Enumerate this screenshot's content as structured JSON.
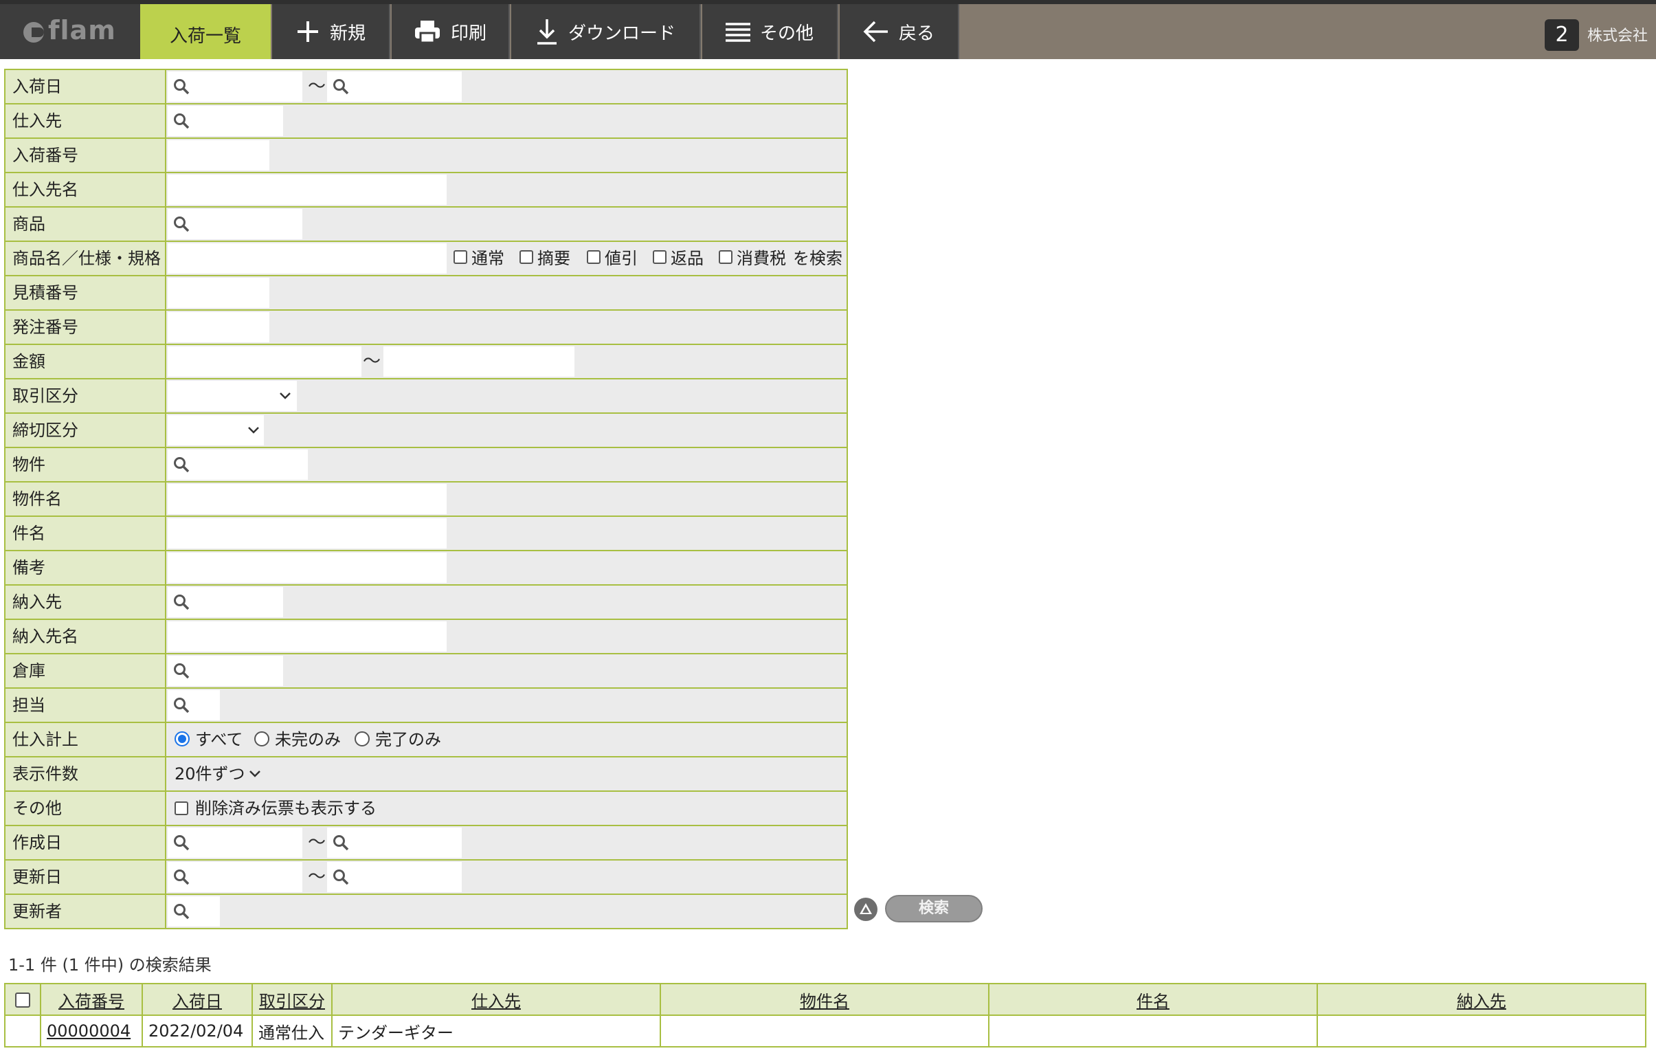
{
  "app": {
    "logo": "flam"
  },
  "nav": {
    "list": "入荷一覧",
    "new": "新規",
    "print": "印刷",
    "download": "ダウンロード",
    "other": "その他",
    "back": "戻る"
  },
  "header": {
    "badge": "2",
    "company": "株式会社"
  },
  "form": {
    "arrival_date": "入荷日",
    "supplier": "仕入先",
    "arrival_no": "入荷番号",
    "supplier_name": "仕入先名",
    "product": "商品",
    "product_name": "商品名／仕様・規格",
    "product_name_opts": [
      "通常",
      "摘要",
      "値引",
      "返品",
      "消費税"
    ],
    "product_name_suffix": "を検索",
    "estimate_no": "見積番号",
    "order_no": "発注番号",
    "amount": "金額",
    "transaction_type": "取引区分",
    "closing_type": "締切区分",
    "property": "物件",
    "property_name": "物件名",
    "subject": "件名",
    "remarks": "備考",
    "delivery_to": "納入先",
    "delivery_name": "納入先名",
    "warehouse": "倉庫",
    "staff": "担当",
    "purchase_posting": "仕入計上",
    "purchase_opts": [
      "すべて",
      "未完のみ",
      "完了のみ"
    ],
    "display_count": "表示件数",
    "display_count_value": "20件ずつ",
    "other": "その他",
    "show_deleted": "削除済み伝票も表示する",
    "created_date": "作成日",
    "updated_date": "更新日",
    "updater": "更新者",
    "tilde": "～"
  },
  "search_button": "検索",
  "result_summary": "1-1 件 (1 件中) の検索結果",
  "table": {
    "headers": [
      "入荷番号",
      "入荷日",
      "取引区分",
      "仕入先",
      "物件名",
      "件名",
      "納入先"
    ],
    "rows": [
      [
        "00000004",
        "2022/02/04",
        "通常仕入",
        "テンダーギター",
        "",
        "",
        ""
      ]
    ]
  },
  "colors": {
    "accent": "#bcd14d",
    "border": "#a8bf42",
    "label_bg": "#e3ebc9",
    "nav_bg": "#3d3d3d",
    "topbar_bg": "#847a6e"
  }
}
